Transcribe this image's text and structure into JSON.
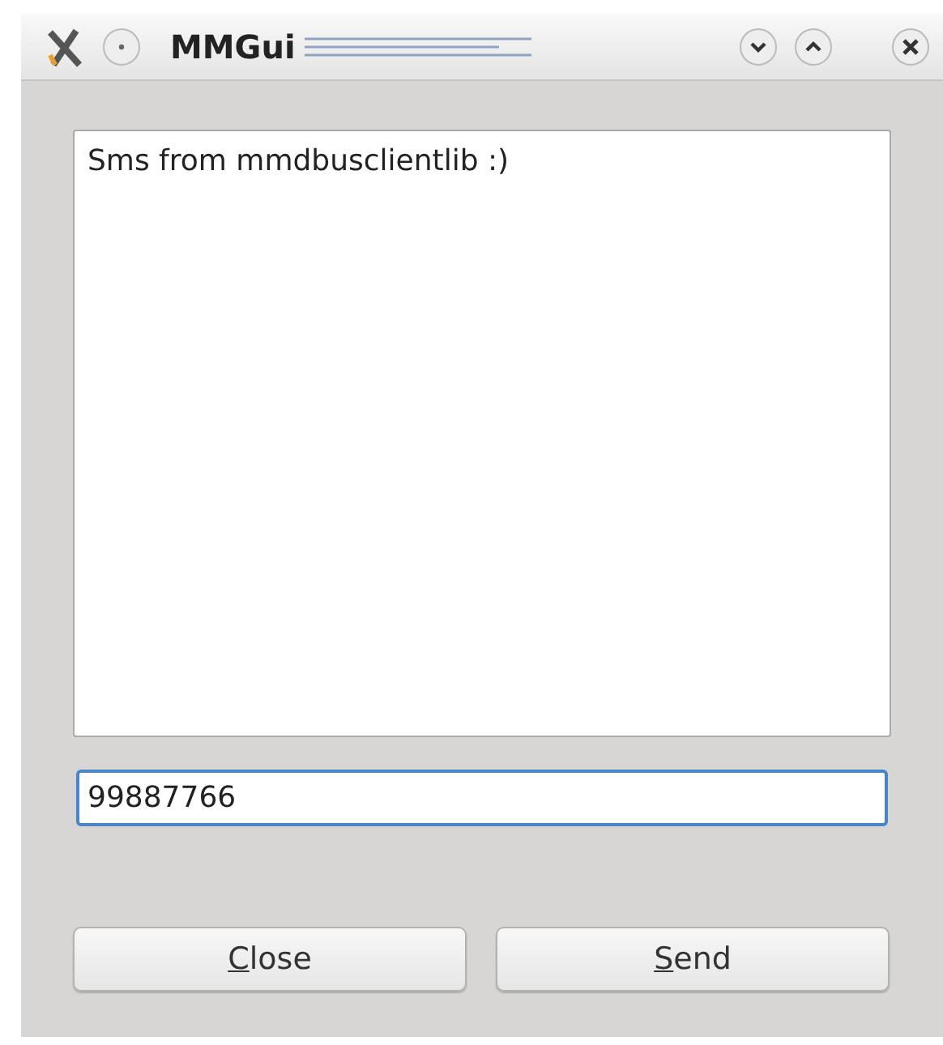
{
  "window": {
    "title": "MMGui"
  },
  "message": {
    "value": "Sms from mmdbusclientlib :)"
  },
  "number_field": {
    "value": "99887766",
    "focused": true
  },
  "buttons": [
    {
      "label": "Close",
      "underline_first": true
    },
    {
      "label": "Send",
      "underline_first": true
    }
  ]
}
